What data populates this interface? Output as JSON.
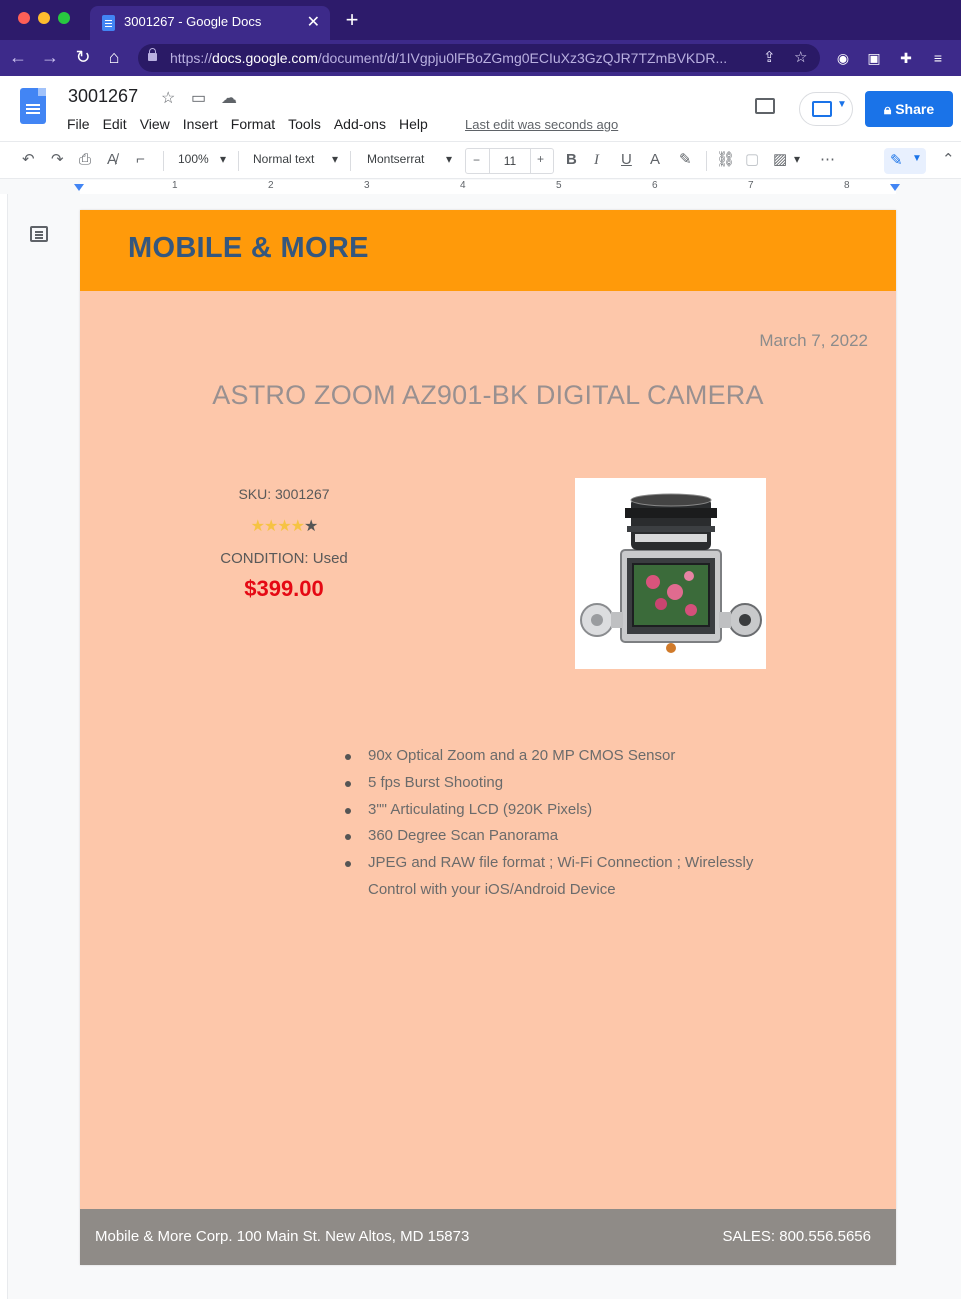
{
  "browser": {
    "tab_title": "3001267 - Google Docs",
    "url_scheme": "https://",
    "url_host": "docs.google.com",
    "url_path": "/document/d/1IVgpju0lFBoZGmg0ECIuXz3GzQJR7TZmBVKDR..."
  },
  "docs": {
    "title": "3001267",
    "menu": [
      "File",
      "Edit",
      "View",
      "Insert",
      "Format",
      "Tools",
      "Add-ons",
      "Help"
    ],
    "last_edit": "Last edit was seconds ago",
    "share_label": "Share"
  },
  "toolbar": {
    "zoom": "100%",
    "style": "Normal text",
    "font": "Montserrat",
    "font_size": "11"
  },
  "ruler": [
    "1",
    "2",
    "3",
    "4",
    "5",
    "6",
    "7",
    "8"
  ],
  "document": {
    "brand": "MOBILE & MORE",
    "date": "March 7, 2022",
    "product_title": "ASTRO ZOOM AZ901-BK DIGITAL CAMERA",
    "sku": "SKU: 3001267",
    "rating": 4,
    "rating_max": 5,
    "condition": "CONDITION: Used",
    "price": "$399.00",
    "features": [
      "90x Optical Zoom and a 20 MP CMOS Sensor",
      "5 fps Burst Shooting",
      "3\"\" Articulating LCD (920K Pixels)",
      "360 Degree Scan Panorama",
      "JPEG and RAW file format ; Wi-Fi Connection ; Wirelessly Control with your iOS/Android Device"
    ],
    "footer_left": "Mobile & More Corp. 100 Main St. New Altos, MD 15873",
    "footer_right": "SALES: 800.556.5656"
  },
  "colors": {
    "page_bg": "#fdc7aa",
    "header_bg": "#ff9a0a",
    "brand_text": "#34577e",
    "price": "#e50914",
    "footer_bg": "#8f8b87",
    "share_button": "#1a73e8"
  }
}
